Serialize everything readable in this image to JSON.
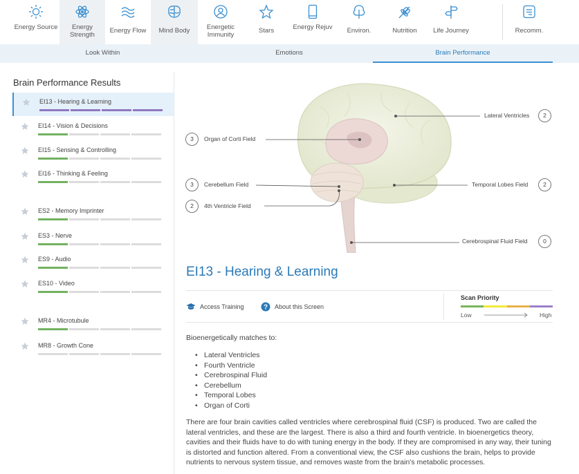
{
  "nav": [
    {
      "label": "Energy Source",
      "icon": "sun-icon"
    },
    {
      "label": "Energy Strength",
      "icon": "atom-icon"
    },
    {
      "label": "Energy Flow",
      "icon": "waves-icon"
    },
    {
      "label": "Mind Body",
      "icon": "brain-icon"
    },
    {
      "label": "Energetic Immunity",
      "icon": "shield-person-icon"
    },
    {
      "label": "Stars",
      "icon": "star-icon"
    },
    {
      "label": "Energy Rejuv",
      "icon": "phone-icon"
    },
    {
      "label": "Environ.",
      "icon": "tree-icon"
    },
    {
      "label": "Nutrition",
      "icon": "wheat-icon"
    },
    {
      "label": "Life Journey",
      "icon": "signpost-icon"
    },
    {
      "label": "Recomm.",
      "icon": "notes-icon"
    }
  ],
  "subtabs": [
    "Look Within",
    "Emotions",
    "Brain Performance"
  ],
  "sidebar": {
    "title": "Brain Performance Results",
    "items": [
      {
        "label": "EI13 - Hearing & Learning",
        "level": 4
      },
      {
        "label": "EI14 - Vision & Decisions",
        "level": 1
      },
      {
        "label": "EI15 - Sensing & Controlling",
        "level": 1
      },
      {
        "label": "EI16 - Thinking & Feeling",
        "level": 1
      },
      {
        "label": "ES2 - Memory Imprinter",
        "level": 1
      },
      {
        "label": "ES3 - Nerve",
        "level": 1
      },
      {
        "label": "ES9 - Audio",
        "level": 1
      },
      {
        "label": "ES10 - Video",
        "level": 1
      },
      {
        "label": "MR4 - Microtubule",
        "level": 1
      },
      {
        "label": "MR8 - Growth Cone",
        "level": 0
      }
    ]
  },
  "figure": {
    "callouts": [
      {
        "label": "Lateral Ventricles",
        "count": "2"
      },
      {
        "label": "Organ of Corti Field",
        "count": "3"
      },
      {
        "label": "Cerebellum Field",
        "count": "3"
      },
      {
        "label": "Temporal Lobes Field",
        "count": "2"
      },
      {
        "label": "4th Ventricle Field",
        "count": "2"
      },
      {
        "label": "Cerebrospinal Fluid Field",
        "count": "0"
      }
    ]
  },
  "detail": {
    "title": "EI13 - Hearing & Learning",
    "access_training": "Access Training",
    "about_screen": "About this Screen",
    "scan_priority": "Scan Priority",
    "low": "Low",
    "high": "High",
    "matches_label": "Bioenergetically matches to:",
    "matches": [
      "Lateral Ventricles",
      "Fourth Ventricle",
      "Cerebrospinal Fluid",
      "Cerebellum",
      "Temporal Lobes",
      "Organ of Corti"
    ],
    "description": "There are four brain cavities called ventricles where cerebrospinal fluid (CSF) is produced. Two are called the lateral ventricles, and these are the largest. There is also a third and fourth ventricle. In bioenergetics theory, cavities and their fluids have to do with tuning energy in the body. If they are compromised in any way, their tuning is distorted and function altered. From a conventional view, the CSF also cushions the brain, helps to provide nutrients to nervous system tissue, and removes waste from the brain's metabolic processes."
  },
  "colors": {
    "accent": "#2a7ab8",
    "priority": [
      "#7ab55c",
      "#f2e93a",
      "#e8b04a",
      "#9a80c8"
    ],
    "bar_green": "#72b160",
    "bar_purple": "#8e78c0"
  }
}
